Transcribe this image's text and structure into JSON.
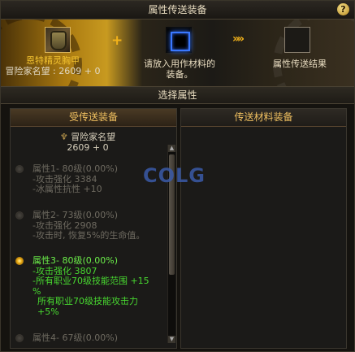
{
  "window": {
    "title": "属性传送装备",
    "help_label": "?"
  },
  "banner": {
    "source_item_name": "恩特精灵胸甲",
    "source_item_stat": "冒险家名望 : 2609 + 0",
    "plus_symbol": "+",
    "material_hint_line1": "请放入用作材料的",
    "material_hint_line2": "装备。",
    "arrows_symbol": "»»",
    "result_label": "属性传送结果"
  },
  "select_bar": {
    "title": "选择属性"
  },
  "left_panel": {
    "header": "受传送装备",
    "reputation_label": "冒险家名望",
    "reputation_value": "2609 + 0",
    "options": [
      {
        "lines": [
          "属性1- 80级(0.00%)",
          "-攻击强化 3384",
          "-冰属性抗性 +10"
        ],
        "selected": false
      },
      {
        "lines": [
          "属性2- 73级(0.00%)",
          "-攻击强化 2908",
          "-攻击时, 恢复5%的生命值。"
        ],
        "selected": false
      },
      {
        "lines": [
          "属性3- 80级(0.00%)",
          "-攻击强化 3807",
          "-所有职业70级技能范围 +15",
          "%",
          "所有职业70级技能攻击力",
          "+5%"
        ],
        "selected": true
      },
      {
        "lines": [
          "属性4- 67级(0.00%)"
        ],
        "selected": false
      }
    ]
  },
  "right_panel": {
    "header": "传送材料装备"
  },
  "watermark": "COLG",
  "icons": {
    "help": "help-icon",
    "source_slot": "armor-icon",
    "material_slot": "empty-slot-icon",
    "result_slot": "empty-slot-icon",
    "reputation": "reputation-emblem-icon",
    "radio": "radio-icon"
  },
  "colors": {
    "accent": "#f2b21a",
    "selected_text": "#48d830",
    "dim_text": "#6e6a60",
    "header_gold": "#f0c060"
  }
}
